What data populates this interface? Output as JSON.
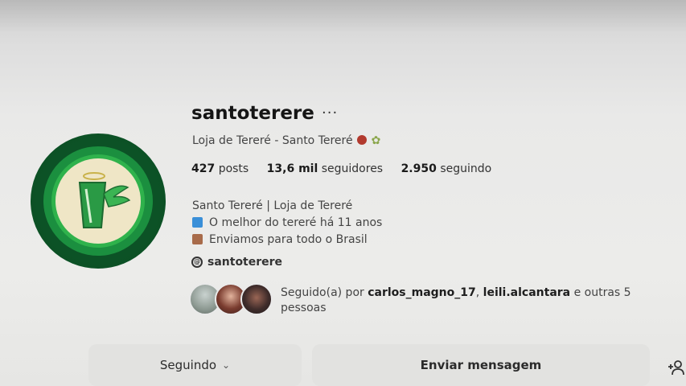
{
  "profile": {
    "username": "santoterere",
    "more_label": "···",
    "full_name": "Loja de Tereré - Santo Tereré",
    "stats": {
      "posts_count": "427",
      "posts_label": "posts",
      "followers_count": "13,6 mil",
      "followers_label": "seguidores",
      "following_count": "2.950",
      "following_label": "seguindo"
    },
    "bio": {
      "line1": "Santo Tereré | Loja de Tereré",
      "line2": "O melhor do tereré há 11 anos",
      "line3": "Enviamos para todo o Brasil"
    },
    "threads_handle": "santoterere",
    "followed_by": {
      "prefix": "Seguido(a) por",
      "user1": "carlos_magno_17",
      "separator": ",",
      "user2": "leili.alcantara",
      "suffix": "e outras 5 pessoas"
    }
  },
  "actions": {
    "following_label": "Seguindo",
    "message_label": "Enviar mensagem"
  },
  "colors": {
    "avatar_dark_green": "#0b4d23",
    "avatar_mid_green": "#1b8f3f",
    "avatar_light_green": "#2fb24c",
    "avatar_cream": "#efe6c6"
  },
  "icons": {
    "more": "ellipsis-icon",
    "threads": "threads-icon",
    "chevron": "chevron-down-icon",
    "add_user": "add-user-icon"
  }
}
